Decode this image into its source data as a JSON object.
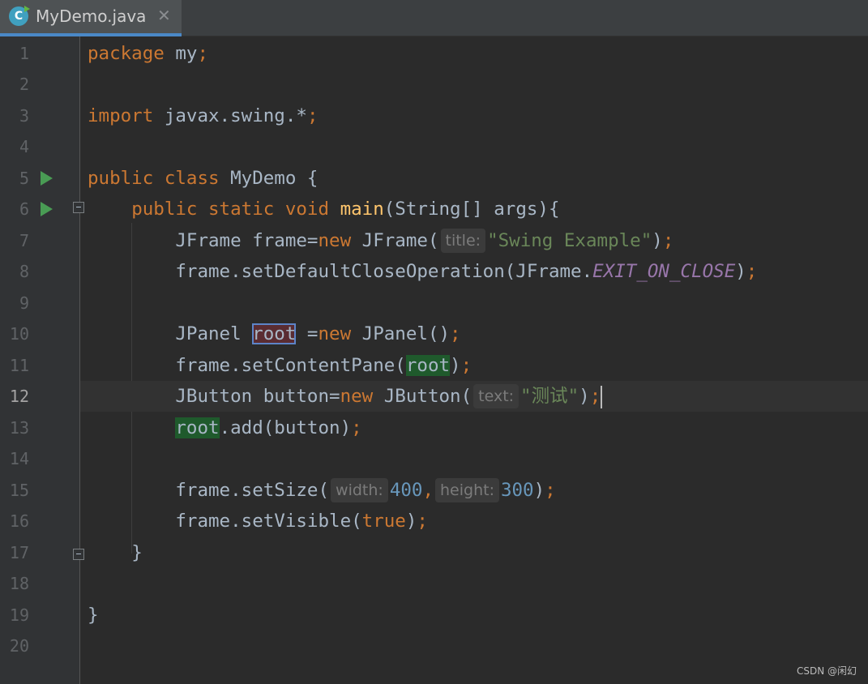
{
  "tab": {
    "title": "MyDemo.java",
    "icon_letter": "C",
    "close_glyph": "✕"
  },
  "lines": [
    {
      "n": "1"
    },
    {
      "n": "2"
    },
    {
      "n": "3"
    },
    {
      "n": "4"
    },
    {
      "n": "5"
    },
    {
      "n": "6"
    },
    {
      "n": "7"
    },
    {
      "n": "8"
    },
    {
      "n": "9"
    },
    {
      "n": "10"
    },
    {
      "n": "11"
    },
    {
      "n": "12"
    },
    {
      "n": "13"
    },
    {
      "n": "14"
    },
    {
      "n": "15"
    },
    {
      "n": "16"
    },
    {
      "n": "17"
    },
    {
      "n": "18"
    },
    {
      "n": "19"
    },
    {
      "n": "20"
    }
  ],
  "code": {
    "l1": {
      "kw": "package",
      "rest": " my",
      "semi": ";"
    },
    "l3": {
      "kw": "import",
      "rest": " javax.swing.*",
      "semi": ";"
    },
    "l5": {
      "kw1": "public",
      "kw2": "class",
      "rest": " MyDemo {"
    },
    "l6": {
      "indent": "    ",
      "kw1": "public",
      "kw2": "static",
      "kw3": "void",
      "fn": "main",
      "rest": "(String[] args){"
    },
    "l7": {
      "indent": "        ",
      "a": "JFrame frame=",
      "kw": "new",
      "b": " JFrame(",
      "hint": "title:",
      "str": "\"Swing Example\"",
      "c": ")",
      "semi": ";"
    },
    "l8": {
      "indent": "        ",
      "a": "frame.setDefaultCloseOperation(JFrame.",
      "const": "EXIT_ON_CLOSE",
      "c": ")",
      "semi": ";"
    },
    "l10": {
      "indent": "        ",
      "a": "JPanel ",
      "decl": "root",
      "b": " =",
      "kw": "new",
      "c": " JPanel()",
      "semi": ";"
    },
    "l11": {
      "indent": "        ",
      "a": "frame.setContentPane(",
      "usage": "root",
      "c": ")",
      "semi": ";"
    },
    "l12": {
      "indent": "        ",
      "a": "JButton button=",
      "kw": "new",
      "b": " JButton(",
      "hint": "text:",
      "str": "\"测试\"",
      "c": ")",
      "semi": ";"
    },
    "l13": {
      "indent": "        ",
      "usage": "root",
      "a": ".add(button)",
      "semi": ";"
    },
    "l15": {
      "indent": "        ",
      "a": "frame.setSize(",
      "hint1": "width:",
      "num1": "400",
      "comma": ",",
      "hint2": "height:",
      "num2": "300",
      "c": ")",
      "semi": ";"
    },
    "l16": {
      "indent": "        ",
      "a": "frame.setVisible(",
      "kw": "true",
      "c": ")",
      "semi": ";"
    },
    "l17": {
      "indent": "    ",
      "a": "}"
    },
    "l19": {
      "a": "}"
    }
  },
  "current_line": "12",
  "watermark": "CSDN @闲幻",
  "colors": {
    "background": "#2b2b2b",
    "gutter": "#313335",
    "keyword": "#cc7832",
    "string": "#6a8759",
    "number": "#6897bb",
    "function": "#ffc66d",
    "constant": "#9876aa",
    "identifier": "#a9b7c6",
    "tab_underline": "#4a88c7"
  }
}
